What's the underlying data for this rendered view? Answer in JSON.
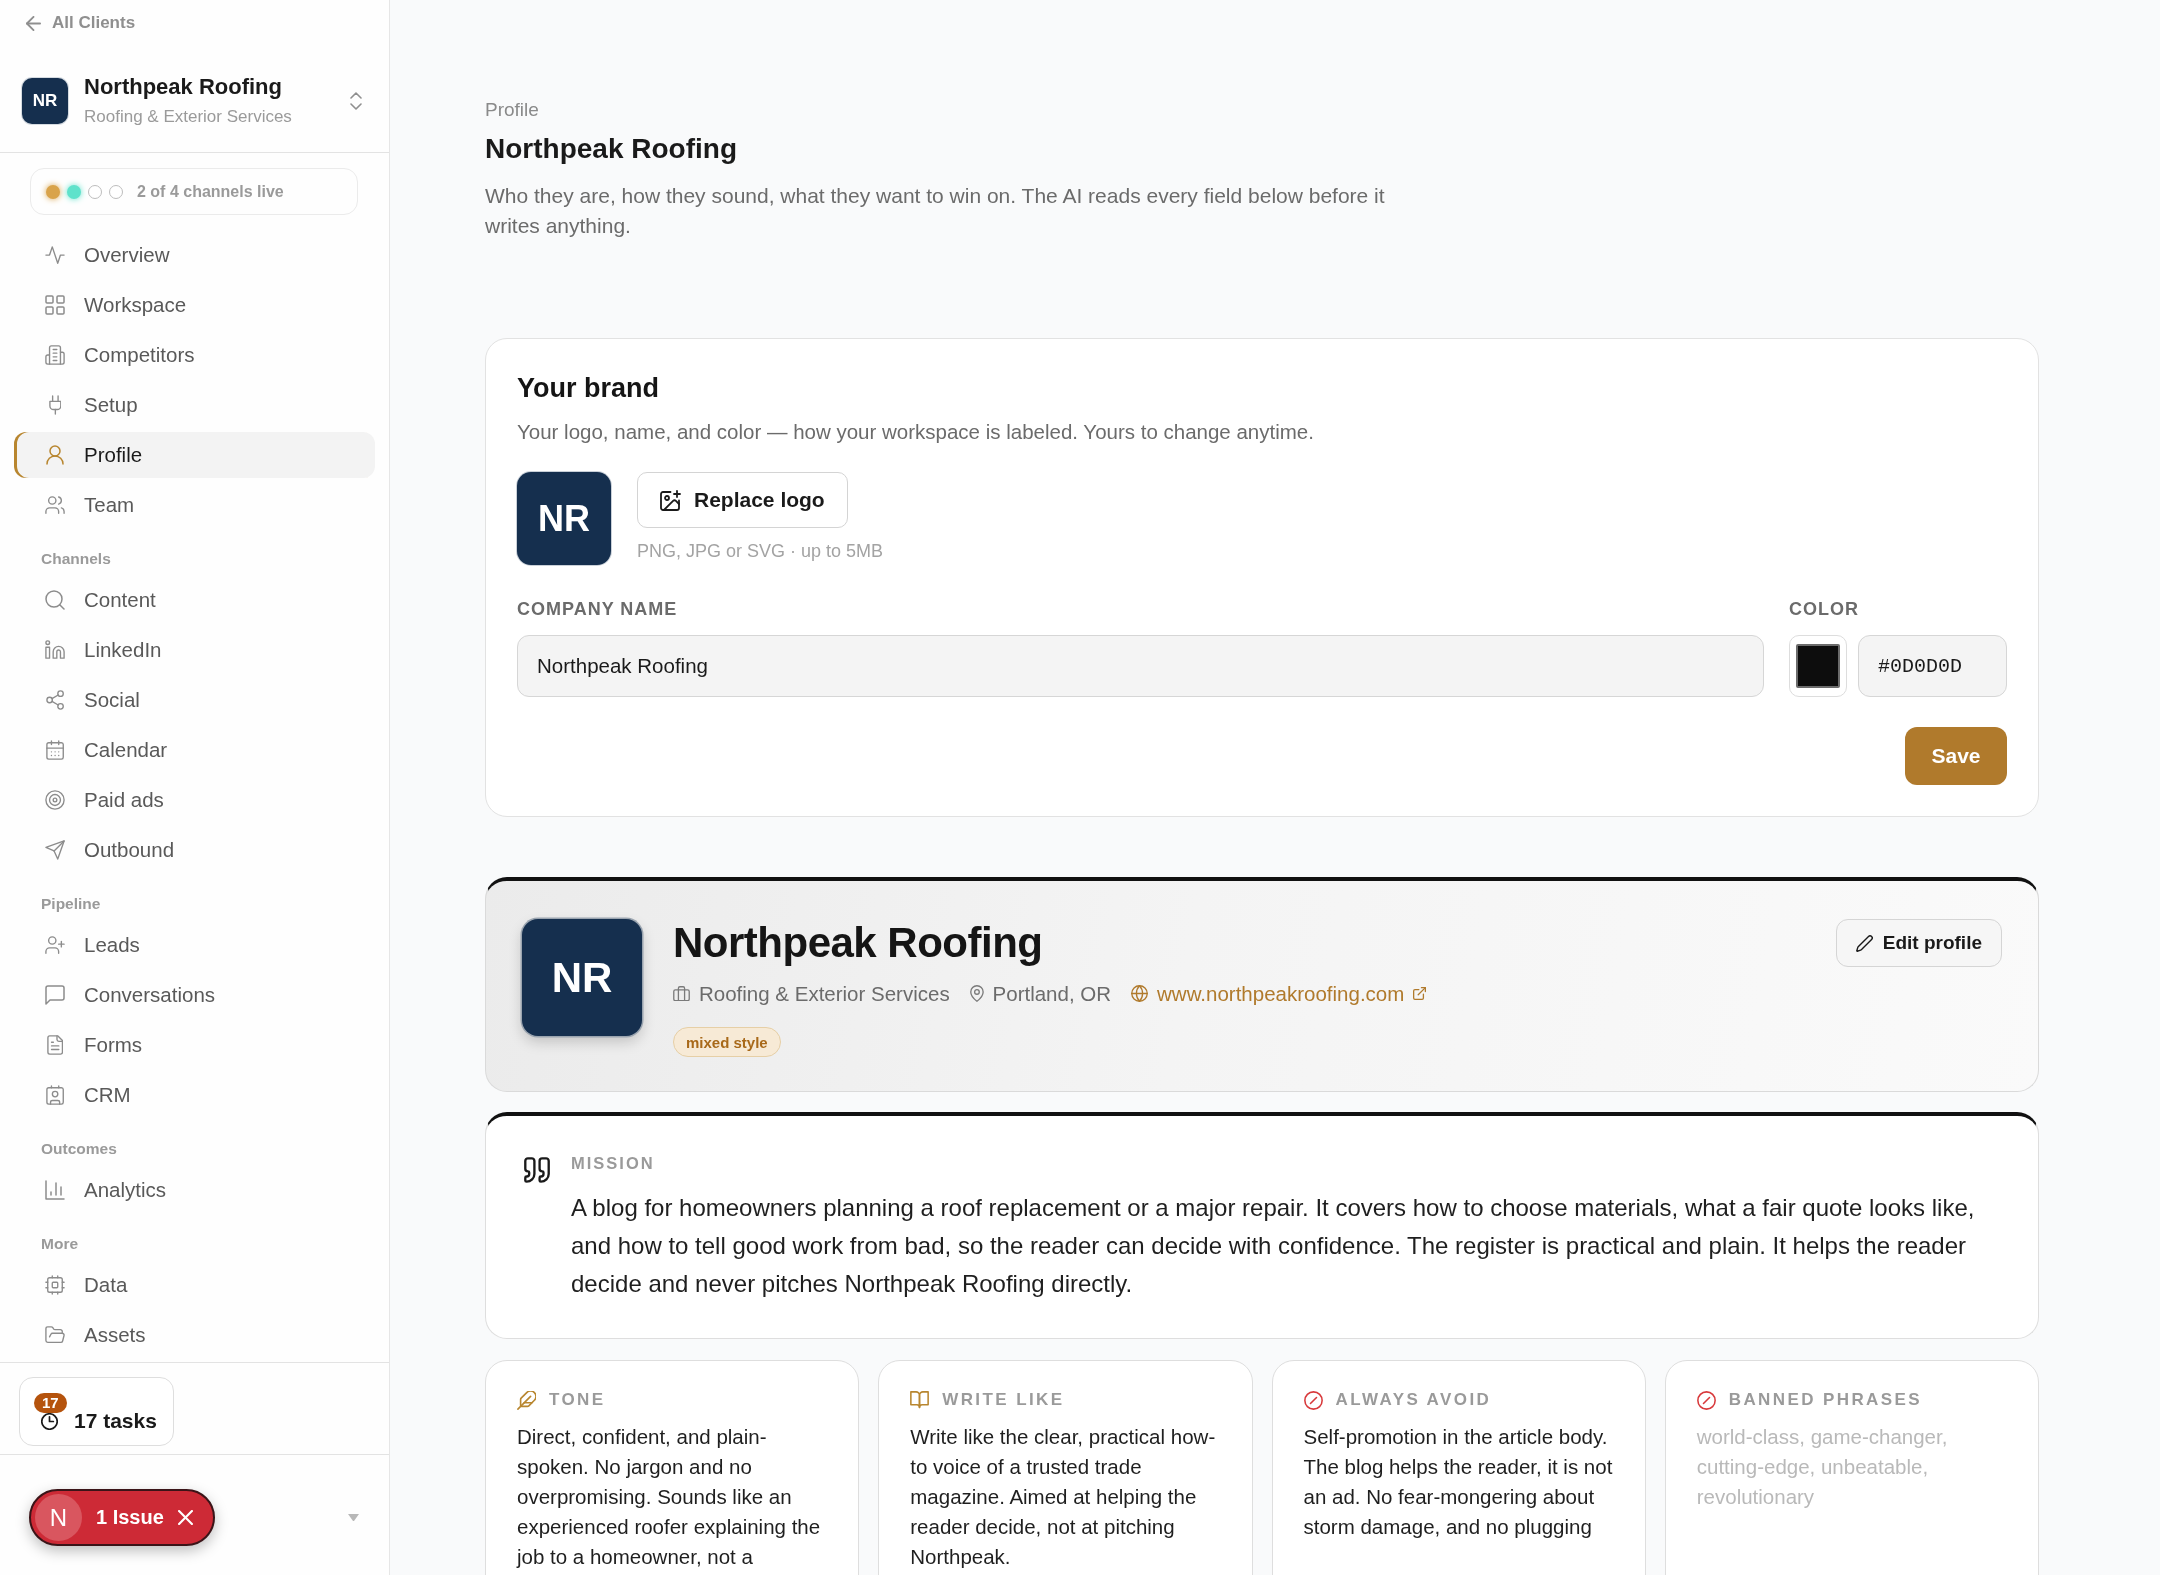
{
  "sidebar": {
    "back_link": "All Clients",
    "client": {
      "logo": "NR",
      "name": "Northpeak Roofing",
      "industry": "Roofing & Exterior Services"
    },
    "channel_status": {
      "dots": [
        {
          "live": true,
          "color": "#d9a34a"
        },
        {
          "live": true,
          "color": "#5fe2cb"
        },
        {
          "live": false
        },
        {
          "live": false
        }
      ],
      "label": "2 of 4 channels live"
    },
    "sections": [
      {
        "items": [
          {
            "label": "Overview",
            "selected": false
          },
          {
            "label": "Workspace",
            "selected": false
          },
          {
            "label": "Competitors",
            "selected": false
          },
          {
            "label": "Setup",
            "selected": false
          },
          {
            "label": "Profile",
            "selected": true
          },
          {
            "label": "Team",
            "selected": false
          }
        ]
      },
      {
        "heading": "Channels",
        "items": [
          {
            "label": "Content",
            "selected": false
          },
          {
            "label": "LinkedIn",
            "selected": false
          },
          {
            "label": "Social",
            "selected": false
          },
          {
            "label": "Calendar",
            "selected": false
          },
          {
            "label": "Paid ads",
            "selected": false
          },
          {
            "label": "Outbound",
            "selected": false
          }
        ]
      },
      {
        "heading": "Pipeline",
        "items": [
          {
            "label": "Leads",
            "selected": false
          },
          {
            "label": "Conversations",
            "selected": false
          },
          {
            "label": "Forms",
            "selected": false
          },
          {
            "label": "CRM",
            "selected": false
          }
        ]
      },
      {
        "heading": "Outcomes",
        "items": [
          {
            "label": "Analytics",
            "selected": false
          }
        ]
      },
      {
        "heading": "More",
        "items": [
          {
            "label": "Data",
            "selected": false
          },
          {
            "label": "Assets",
            "selected": false
          }
        ]
      }
    ],
    "tasks": {
      "badge": "17",
      "label": "17 tasks"
    },
    "dev_indicator": {
      "logo": "N",
      "label": "1 Issue"
    }
  },
  "header": {
    "eyebrow": "Profile",
    "title": "Northpeak Roofing",
    "description": "Who they are, how they sound, what they want to win on. The AI reads every field below before it writes anything."
  },
  "brand": {
    "title": "Your brand",
    "subtitle": "Your logo, name, and color — how your workspace is labeled. Yours to change anytime.",
    "logo": "NR",
    "replace_button": "Replace logo",
    "hint": "PNG, JPG or SVG · up to 5MB",
    "company_name": {
      "label": "COMPANY NAME",
      "value": "Northpeak Roofing"
    },
    "color": {
      "label": "COLOR",
      "color": "#0d0d0d",
      "value": "#0D0D0D"
    },
    "save_button": "Save"
  },
  "profile": {
    "logo": "NR",
    "name": "Northpeak Roofing",
    "industry": "Roofing & Exterior Services",
    "location": "Portland, OR",
    "website": "www.northpeakroofing.com",
    "tag": "mixed style",
    "edit_button": "Edit profile"
  },
  "mission": {
    "label": "MISSION",
    "text": "A blog for homeowners planning a roof replacement or a major repair. It covers how to choose materials, what a fair quote looks like, and how to tell good work from bad, so the reader can decide with confidence. The register is practical and plain. It helps the reader decide and never pitches Northpeak Roofing directly."
  },
  "guidelines": [
    {
      "kind": "tone",
      "label": "TONE",
      "text": "Direct, confident, and plain-spoken. No jargon and no overpromising. Sounds like an experienced roofer explaining the job to a homeowner, not a"
    },
    {
      "kind": "style",
      "label": "WRITE LIKE",
      "text": "Write like the clear, practical how-to voice of a trusted trade magazine. Aimed at helping the reader decide, not at pitching Northpeak."
    },
    {
      "kind": "avoid",
      "label": "ALWAYS AVOID",
      "text": "Self-promotion in the article body. The blog helps the reader, it is not an ad. No fear-mongering about storm damage, and no plugging"
    },
    {
      "kind": "banned",
      "label": "BANNED PHRASES",
      "text": "world-class, game-changer, cutting-edge, unbeatable, revolutionary"
    }
  ]
}
